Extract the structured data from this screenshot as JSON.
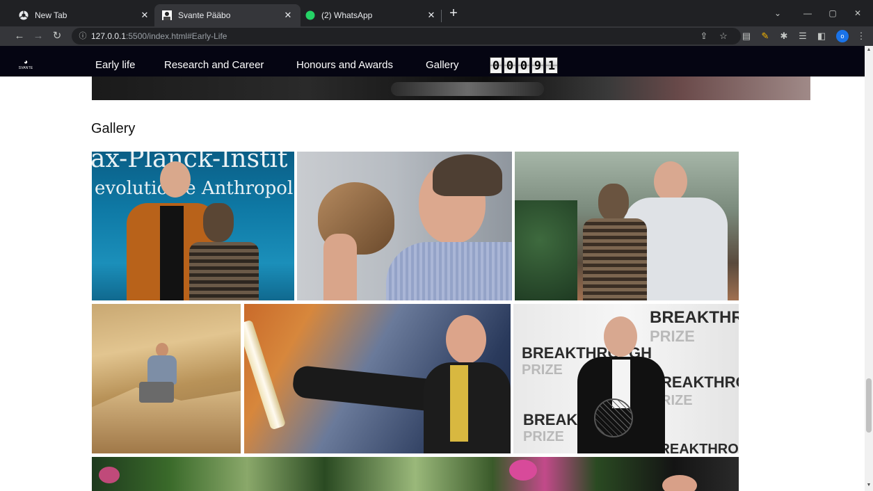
{
  "browser": {
    "tabs": [
      {
        "title": "New Tab",
        "active": false
      },
      {
        "title": "Svante Pääbo",
        "active": true
      },
      {
        "title": "(2) WhatsApp",
        "active": false,
        "badge": "2"
      }
    ],
    "address": {
      "host": "127.0.0.1",
      "rest": ":5500/index.html#Early-Life"
    },
    "profile_initial": "o"
  },
  "site": {
    "logo_text": "SVANTE",
    "nav": [
      "Early life",
      "Research and Career",
      "Honours and Awards",
      "Gallery"
    ],
    "visitor_counter": [
      "0",
      "0",
      "0",
      "9",
      "1"
    ]
  },
  "gallery": {
    "title": "Gallery",
    "sign_text": [
      "ax-Planck-Instit",
      "evolution   e Anthropol"
    ],
    "breakthrough": [
      "BREAKTHRO",
      "PRIZE",
      "BREAKTHRO",
      "GH",
      "PRIZE",
      "REAKTHRO",
      "RIZE",
      "BREAK",
      "PRIZE",
      "BREAKTHRO"
    ]
  }
}
